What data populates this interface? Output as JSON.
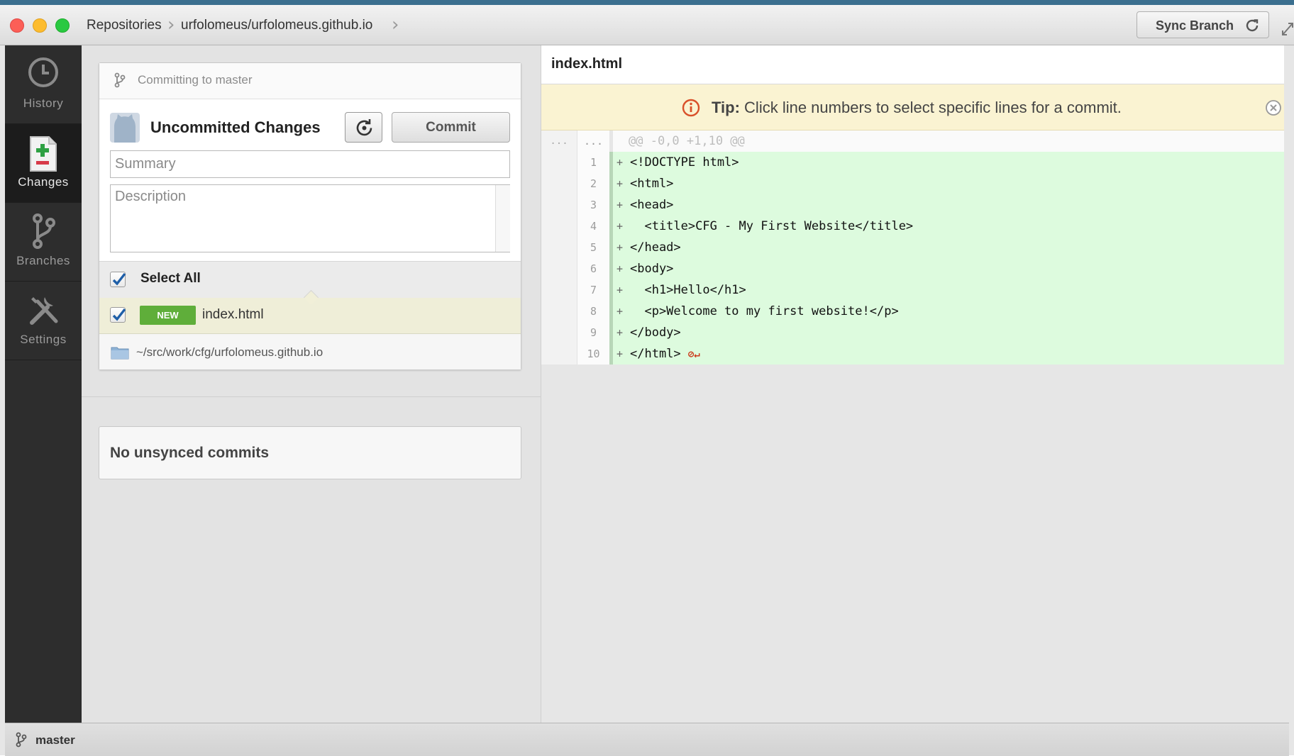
{
  "titlebar": {
    "breadcrumb_root": "Repositories",
    "breadcrumb_repo": "urfolomeus/urfolomeus.github.io",
    "sync_label": "Sync Branch"
  },
  "nav": {
    "items": [
      {
        "label": "History",
        "icon": "history-icon",
        "active": false
      },
      {
        "label": "Changes",
        "icon": "changes-icon",
        "active": true
      },
      {
        "label": "Branches",
        "icon": "branch-icon",
        "active": false
      },
      {
        "label": "Settings",
        "icon": "settings-icon",
        "active": false
      }
    ]
  },
  "commit_panel": {
    "committing_to": "Committing to master",
    "title": "Uncommitted Changes",
    "commit_label": "Commit",
    "summary_placeholder": "Summary",
    "description_placeholder": "Description",
    "select_all_label": "Select All",
    "file": {
      "badge": "NEW",
      "name": "index.html",
      "checked": true
    },
    "repo_path": "~/src/work/cfg/urfolomeus.github.io",
    "unsynced": "No unsynced commits"
  },
  "diff": {
    "file_title": "index.html",
    "tip_bold": "Tip:",
    "tip_text": "Click line numbers to select specific lines for a commit.",
    "hunk": {
      "old": "...",
      "new": "...",
      "text": "@@ -0,0 +1,10 @@"
    },
    "lines": [
      {
        "num": "1",
        "sign": "+",
        "code": "<!DOCTYPE html>"
      },
      {
        "num": "2",
        "sign": "+",
        "code": "<html>"
      },
      {
        "num": "3",
        "sign": "+",
        "code": "<head>"
      },
      {
        "num": "4",
        "sign": "+",
        "code": "  <title>CFG - My First Website</title>"
      },
      {
        "num": "5",
        "sign": "+",
        "code": "</head>"
      },
      {
        "num": "6",
        "sign": "+",
        "code": "<body>"
      },
      {
        "num": "7",
        "sign": "+",
        "code": "  <h1>Hello</h1>"
      },
      {
        "num": "8",
        "sign": "+",
        "code": "  <p>Welcome to my first website!</p>"
      },
      {
        "num": "9",
        "sign": "+",
        "code": "</body>"
      },
      {
        "num": "10",
        "sign": "+",
        "code": "</html>"
      }
    ],
    "eol_marker": "⊘↵"
  },
  "status": {
    "branch": "master"
  },
  "colors": {
    "nav_bg": "#2d2d2d",
    "added_line_bg": "#ddfbde",
    "new_badge": "#5fae3a",
    "tip_bg": "#faf3d2",
    "tip_icon": "#d9502a"
  }
}
